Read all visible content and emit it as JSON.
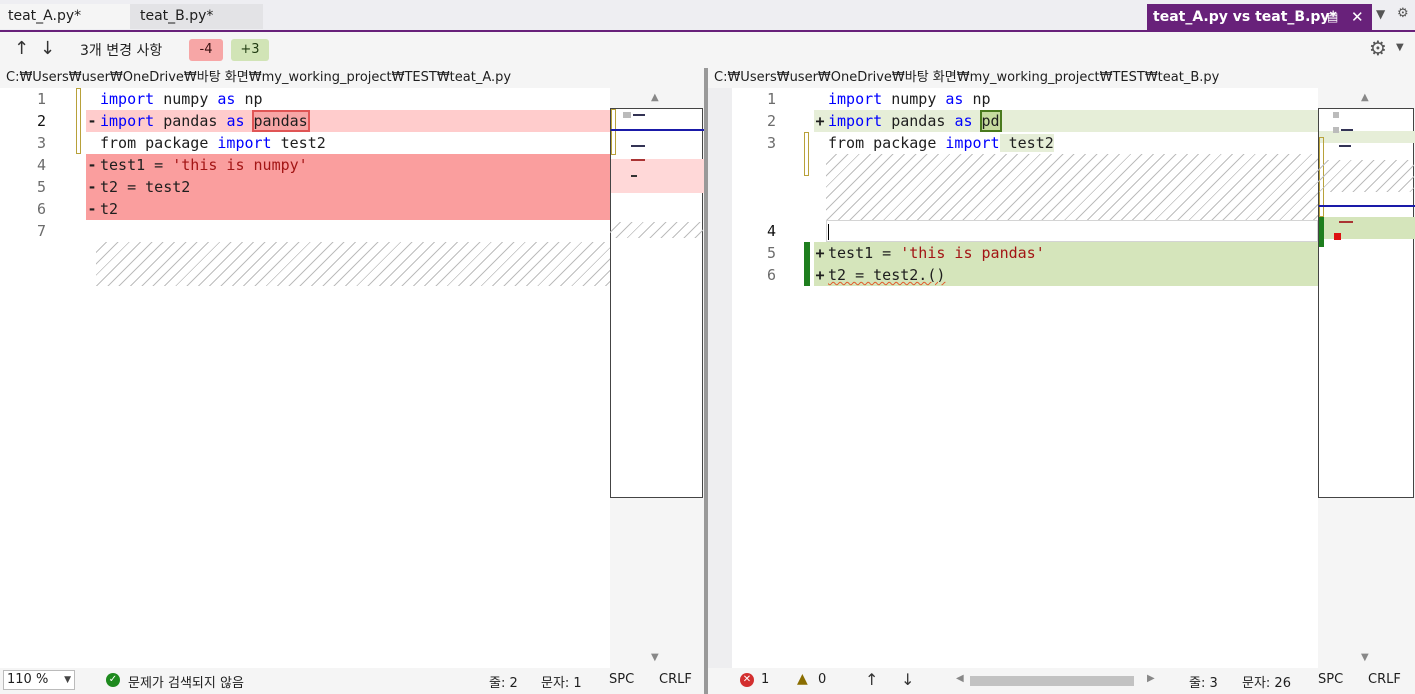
{
  "tabs": {
    "tab_a": "teat_A.py*",
    "tab_b": "teat_B.py*",
    "diff_tab": "teat_A.py vs teat_B.py*",
    "pin_icon": "pin-icon",
    "close_icon": "close-icon"
  },
  "toolbar": {
    "changes_label": "3개 변경 사항",
    "removed_badge": "-4",
    "added_badge": "+3",
    "removed_color": "#f7a6a6",
    "added_color": "#d1e4b6"
  },
  "left": {
    "path": "C:₩Users₩user₩OneDrive₩바탕 화면₩my_working_project₩TEST₩teat_A.py",
    "line_numbers": [
      "1",
      "2",
      "3",
      "4",
      "5",
      "6",
      "7"
    ],
    "code": {
      "l1_a": "import",
      "l1_b": " numpy ",
      "l1_c": "as",
      "l1_d": " np",
      "l2_a": "import",
      "l2_b": " pandas ",
      "l2_c": "as",
      "l2_d": "pandas",
      "l3_a": "from package ",
      "l3_b": "import",
      "l3_c": " test2",
      "l4_a": "test1 = ",
      "l4_b": "'this is numpy'",
      "l5": "t2 = test2",
      "l6": "t2"
    },
    "minus_marker": "-"
  },
  "right": {
    "path": "C:₩Users₩user₩OneDrive₩바탕 화면₩my_working_project₩TEST₩teat_B.py",
    "line_numbers": [
      "1",
      "2",
      "3",
      "4",
      "5",
      "6"
    ],
    "code": {
      "l1_a": "import",
      "l1_b": " numpy ",
      "l1_c": "as",
      "l1_d": " np",
      "l2_a": "import",
      "l2_b": " pandas ",
      "l2_c": "as",
      "l2_d": "pd",
      "l3_a": "from package ",
      "l3_b": "import",
      "l3_c": " test2",
      "l5_a": "test1 = ",
      "l5_b": "'this is pandas'",
      "l6": "t2 = test2.()"
    },
    "plus_marker": "+"
  },
  "status_left": {
    "zoom": "110 %",
    "issues": "문제가 검색되지 않음",
    "line": "줄: 2",
    "col": "문자: 1",
    "spc": "SPC",
    "crlf": "CRLF"
  },
  "status_right": {
    "errors": "1",
    "warnings": "0",
    "line": "줄: 3",
    "col": "문자: 26",
    "spc": "SPC",
    "crlf": "CRLF"
  }
}
